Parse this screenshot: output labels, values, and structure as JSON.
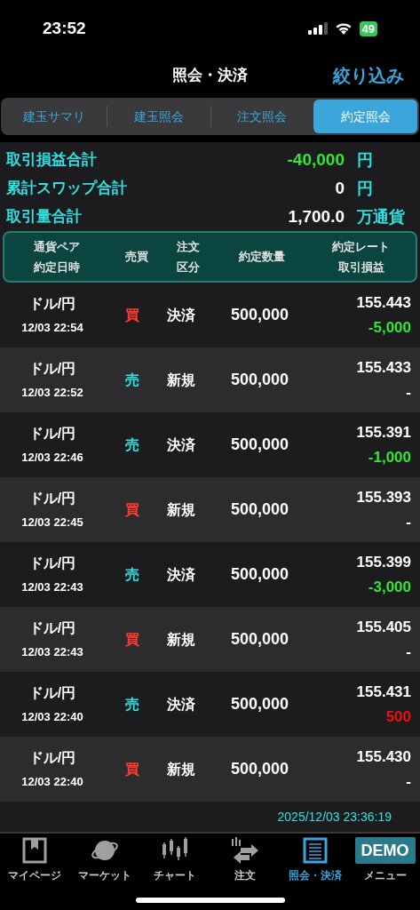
{
  "status_bar": {
    "time": "23:52",
    "battery": "49"
  },
  "header": {
    "title": "照会・決済",
    "action": "絞り込み"
  },
  "tabs": [
    {
      "label": "建玉サマリ",
      "selected": false
    },
    {
      "label": "建玉照会",
      "selected": false
    },
    {
      "label": "注文照会",
      "selected": false
    },
    {
      "label": "約定照会",
      "selected": true
    }
  ],
  "summary": [
    {
      "label": "取引損益合計",
      "value": "-40,000",
      "unit": "円",
      "color": "#33e633"
    },
    {
      "label": "累計スワップ合計",
      "value": "0",
      "unit": "円",
      "color": "#ffffff"
    },
    {
      "label": "取引量合計",
      "value": "1,700.0",
      "unit": "万通貨",
      "color": "#ffffff"
    }
  ],
  "table": {
    "columns": [
      [
        "通貨ペア",
        "約定日時"
      ],
      [
        "売買"
      ],
      [
        "注文",
        "区分"
      ],
      [
        "約定数量"
      ],
      [
        "約定レート",
        "取引損益"
      ]
    ],
    "rows": [
      {
        "pair": "ドル/円",
        "time": "12/03 22:54",
        "side": {
          "text": "買",
          "kind": "buy"
        },
        "type": "決済",
        "qty": "500,000",
        "rate": "155.443",
        "pl": {
          "text": "-5,000",
          "color": "#33e633"
        }
      },
      {
        "pair": "ドル/円",
        "time": "12/03 22:52",
        "side": {
          "text": "売",
          "kind": "sell"
        },
        "type": "新規",
        "qty": "500,000",
        "rate": "155.433",
        "pl": {
          "text": "-",
          "color": "#ffffff"
        }
      },
      {
        "pair": "ドル/円",
        "time": "12/03 22:46",
        "side": {
          "text": "売",
          "kind": "sell"
        },
        "type": "決済",
        "qty": "500,000",
        "rate": "155.391",
        "pl": {
          "text": "-1,000",
          "color": "#33e633"
        }
      },
      {
        "pair": "ドル/円",
        "time": "12/03 22:45",
        "side": {
          "text": "買",
          "kind": "buy"
        },
        "type": "新規",
        "qty": "500,000",
        "rate": "155.393",
        "pl": {
          "text": "-",
          "color": "#ffffff"
        }
      },
      {
        "pair": "ドル/円",
        "time": "12/03 22:43",
        "side": {
          "text": "売",
          "kind": "sell"
        },
        "type": "決済",
        "qty": "500,000",
        "rate": "155.399",
        "pl": {
          "text": "-3,000",
          "color": "#33e633"
        }
      },
      {
        "pair": "ドル/円",
        "time": "12/03 22:43",
        "side": {
          "text": "買",
          "kind": "buy"
        },
        "type": "新規",
        "qty": "500,000",
        "rate": "155.405",
        "pl": {
          "text": "-",
          "color": "#ffffff"
        }
      },
      {
        "pair": "ドル/円",
        "time": "12/03 22:40",
        "side": {
          "text": "売",
          "kind": "sell"
        },
        "type": "決済",
        "qty": "500,000",
        "rate": "155.431",
        "pl": {
          "text": "500",
          "color": "#ee1111"
        }
      },
      {
        "pair": "ドル/円",
        "time": "12/03 22:40",
        "side": {
          "text": "買",
          "kind": "buy"
        },
        "type": "新規",
        "qty": "500,000",
        "rate": "155.430",
        "pl": {
          "text": "-",
          "color": "#ffffff"
        }
      }
    ]
  },
  "updated": "2025/12/03 23:36:19",
  "nav": [
    {
      "label": "マイページ",
      "kind": "mypage",
      "selected": false
    },
    {
      "label": "マーケット",
      "kind": "market",
      "selected": false
    },
    {
      "label": "チャート",
      "kind": "chart",
      "selected": false
    },
    {
      "label": "注文",
      "kind": "order",
      "selected": false
    },
    {
      "label": "照会・決済",
      "kind": "list",
      "selected": true
    },
    {
      "label": "メニュー",
      "kind": "menu",
      "badge": "DEMO",
      "selected": false
    }
  ]
}
